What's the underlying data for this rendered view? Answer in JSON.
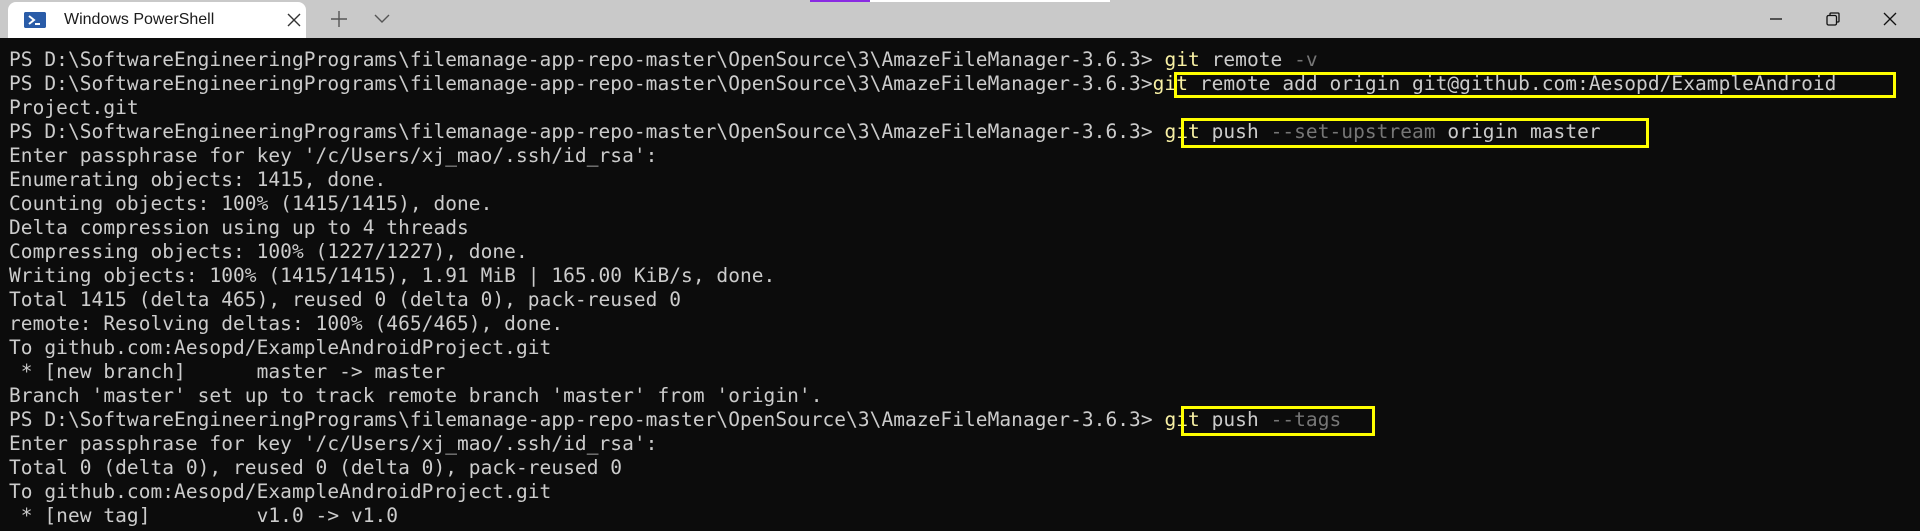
{
  "window": {
    "tab_title": "Windows PowerShell",
    "icons": {
      "tab": "powershell-icon",
      "close_tab": "close-icon",
      "new_tab": "plus-icon",
      "dropdown": "chevron-down-icon",
      "minimize": "minimize-icon",
      "maximize": "restore-icon",
      "close": "close-icon"
    }
  },
  "colors": {
    "terminal_bg": "#0c0c0c",
    "text": "#cccccc",
    "command": "#f9f1a5",
    "parameter": "#767676",
    "highlight_box": "#ffff00",
    "titlebar": "#c9c9c9"
  },
  "terminal": {
    "prompt": "PS D:\\SoftwareEngineeringPrograms\\filemanage-app-repo-master\\OpenSource\\3\\AmazeFileManager-3.6.3>",
    "cmd1": {
      "exe": "git",
      "rest": " remote ",
      "param": "-v"
    },
    "cmd2": {
      "exe": "git",
      "rest": " remote add origin git@github.com:Aesopd/ExampleAndroid"
    },
    "cmd2_wrap": "Project.git",
    "cmd3": {
      "exe": "git",
      "rest1": " push ",
      "param": "--set-upstream",
      "rest2": " origin master"
    },
    "out1": [
      "Enter passphrase for key '/c/Users/xj_mao/.ssh/id_rsa':",
      "Enumerating objects: 1415, done.",
      "Counting objects: 100% (1415/1415), done.",
      "Delta compression using up to 4 threads",
      "Compressing objects: 100% (1227/1227), done.",
      "Writing objects: 100% (1415/1415), 1.91 MiB | 165.00 KiB/s, done.",
      "Total 1415 (delta 465), reused 0 (delta 0), pack-reused 0",
      "remote: Resolving deltas: 100% (465/465), done.",
      "To github.com:Aesopd/ExampleAndroidProject.git",
      " * [new branch]      master -> master",
      "Branch 'master' set up to track remote branch 'master' from 'origin'."
    ],
    "cmd4": {
      "exe": "git",
      "rest": " push ",
      "param": "--tags"
    },
    "out2": [
      "Enter passphrase for key '/c/Users/xj_mao/.ssh/id_rsa':",
      "Total 0 (delta 0), reused 0 (delta 0), pack-reused 0",
      "To github.com:Aesopd/ExampleAndroidProject.git",
      " * [new tag]         v1.0 -> v1.0"
    ]
  }
}
